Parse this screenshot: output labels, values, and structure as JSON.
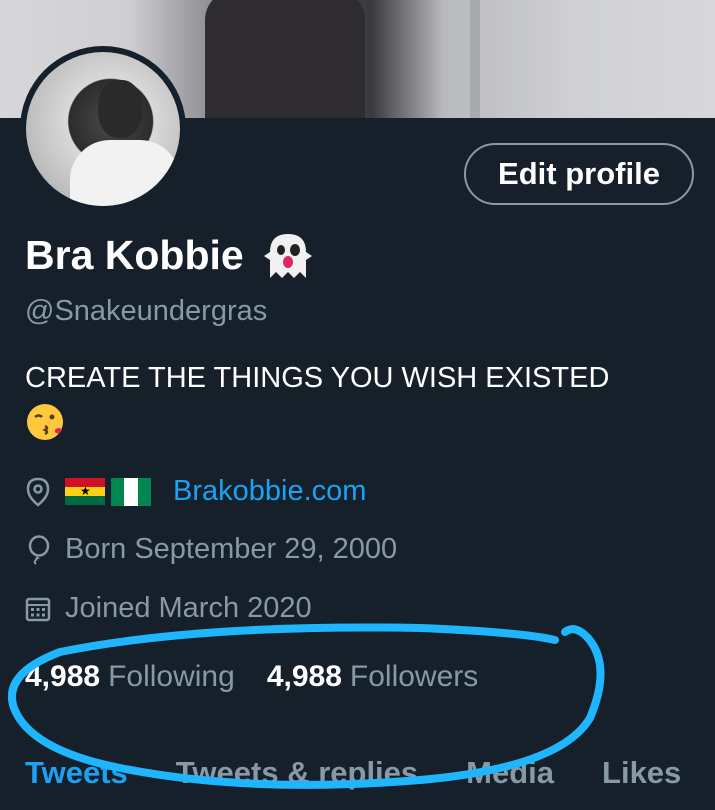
{
  "profile": {
    "edit_button": "Edit profile",
    "name": "Bra Kobbie",
    "handle": "@Snakeundergras",
    "bio": "CREATE THE THINGS YOU WISH EXISTED",
    "website": "Brakobbie.com",
    "born": "Born September 29, 2000",
    "joined": "Joined March 2020"
  },
  "stats": {
    "following_count": "4,988",
    "following_label": "Following",
    "followers_count": "4,988",
    "followers_label": "Followers"
  },
  "tabs": [
    {
      "label": "Tweets"
    },
    {
      "label": "Tweets & replies"
    },
    {
      "label": "Media"
    },
    {
      "label": "Likes"
    }
  ],
  "colors": {
    "background": "#15202b",
    "accent": "#1da1f2",
    "muted": "#8899a6",
    "annotation": "#1fb6ff"
  },
  "icons": [
    "location-icon",
    "birthday-balloon-icon",
    "calendar-icon",
    "ghost-emoji",
    "kiss-emoji"
  ]
}
